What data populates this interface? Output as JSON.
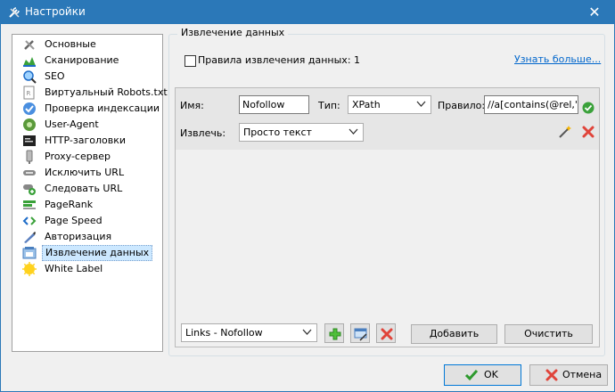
{
  "window": {
    "title": "Настройки",
    "close_glyph": "✕"
  },
  "sidebar": {
    "items": [
      {
        "label": "Основные",
        "icon": "tools-icon",
        "selected": false
      },
      {
        "label": "Сканирование",
        "icon": "scan-chart-icon",
        "selected": false
      },
      {
        "label": "SEO",
        "icon": "seo-magnifier-icon",
        "selected": false
      },
      {
        "label": "Виртуальный Robots.txt",
        "icon": "robots-file-icon",
        "selected": false
      },
      {
        "label": "Проверка индексации",
        "icon": "index-check-icon",
        "selected": false
      },
      {
        "label": "User-Agent",
        "icon": "user-agent-icon",
        "selected": false
      },
      {
        "label": "HTTP-заголовки",
        "icon": "http-headers-icon",
        "selected": false
      },
      {
        "label": "Proxy-сервер",
        "icon": "proxy-server-icon",
        "selected": false
      },
      {
        "label": "Исключить URL",
        "icon": "exclude-url-icon",
        "selected": false
      },
      {
        "label": "Следовать URL",
        "icon": "follow-url-icon",
        "selected": false
      },
      {
        "label": "PageRank",
        "icon": "pagerank-icon",
        "selected": false
      },
      {
        "label": "Page Speed",
        "icon": "page-speed-icon",
        "selected": false
      },
      {
        "label": "Авторизация",
        "icon": "auth-pen-icon",
        "selected": false
      },
      {
        "label": "Извлечение данных",
        "icon": "data-extraction-icon",
        "selected": true
      },
      {
        "label": "White Label",
        "icon": "white-label-icon",
        "selected": false
      }
    ]
  },
  "extraction": {
    "group_title": "Извлечение данных",
    "rules_label": "Правила извлечения данных: 1",
    "rules_checked": false,
    "learn_more": "Узнать больше...",
    "rule": {
      "name_label": "Имя:",
      "name_value": "Nofollow",
      "type_label": "Тип:",
      "type_value": "XPath",
      "rule_label": "Правило:",
      "rule_value": "//a[contains(@rel,'n",
      "extract_label": "Извлечь:",
      "extract_value": "Просто текст"
    },
    "preset_value": "Links - Nofollow",
    "add_button": "Добавить",
    "clear_button": "Очистить"
  },
  "footer": {
    "ok": "OK",
    "cancel": "Отмена"
  },
  "colors": {
    "titlebar": "#2b78b8",
    "link": "#0066cc",
    "selection": "#cce8ff"
  }
}
